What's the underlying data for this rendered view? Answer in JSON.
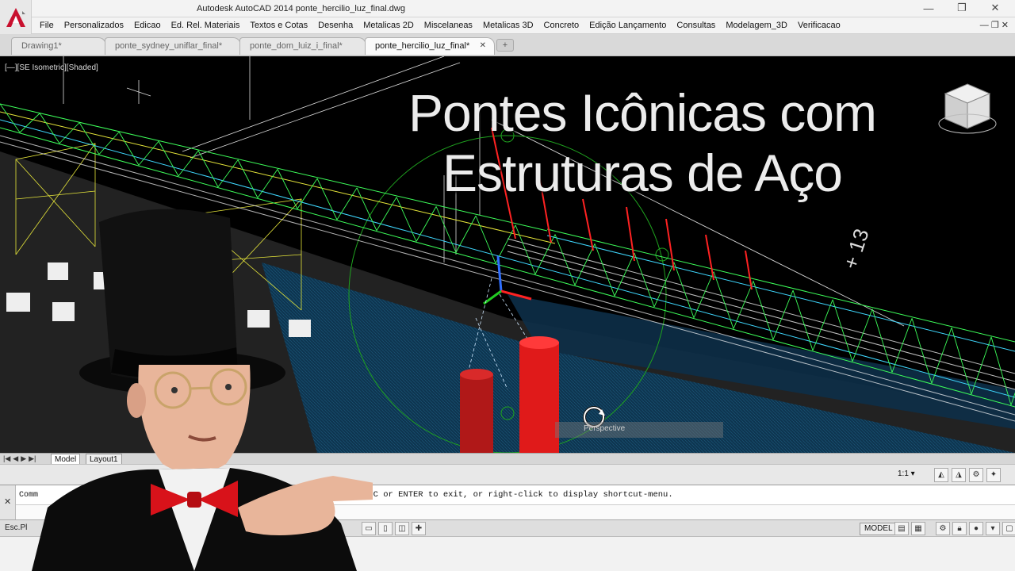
{
  "app": {
    "title": "Autodesk AutoCAD 2014    ponte_hercilio_luz_final.dwg",
    "window_controls": {
      "minimize": "—",
      "maximize": "❐",
      "close": "✕"
    },
    "doc_controls": "— ❐ ✕"
  },
  "menu": {
    "items": [
      "File",
      "Personalizados",
      "Edicao",
      "Ed. Rel. Materiais",
      "Textos e Cotas",
      "Desenha",
      "Metalicas 2D",
      "Miscelaneas",
      "Metalicas 3D",
      "Concreto",
      "Edição Lançamento",
      "Consultas",
      "Modelagem_3D",
      "Verificacao"
    ]
  },
  "tabs": [
    {
      "label": "Drawing1*",
      "active": false
    },
    {
      "label": "ponte_sydney_uniflar_final*",
      "active": false
    },
    {
      "label": "ponte_dom_luiz_i_final*",
      "active": false
    },
    {
      "label": "ponte_hercilio_luz_final*",
      "active": true
    }
  ],
  "tab_close": "✕",
  "tab_add": "+",
  "viewport": {
    "label": "[—][SE Isometric][Shaded]",
    "overlay_line1": "Pontes Icônicas com",
    "overlay_line2": "Estruturas de Aço",
    "tooltip": "Perspective"
  },
  "layout_tabs": {
    "nav": [
      "|◀",
      "◀",
      "▶",
      "▶|"
    ],
    "model": "Model",
    "layout1": "Layout1"
  },
  "annotation": {
    "scale": "1:1 ▾"
  },
  "command": {
    "history_prefix": "Comm",
    "line": "ESC or ENTER to exit, or right-click to display shortcut-menu.",
    "close": "✕"
  },
  "status": {
    "left": "Esc.Pl",
    "model": "MODEL"
  },
  "colors": {
    "truss_green": "#3dff5a",
    "truss_yellow": "#e6e63a",
    "truss_cyan": "#3fd8ff",
    "water": "#0f3a55",
    "pier_red": "#e01a1a",
    "cable_red": "#ff2222",
    "acad_red": "#c8102e"
  }
}
